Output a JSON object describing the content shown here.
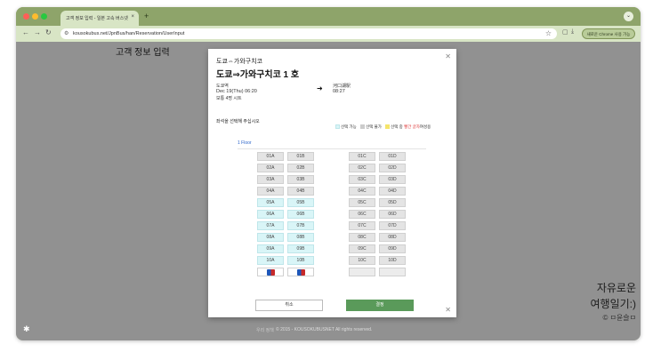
{
  "browser": {
    "tab_title": "고객 정보 입력 - 일본 고속 버스넷",
    "tab_close": "×",
    "new_tab": "+",
    "url": "kousokubus.net/JpnBus/han/Reservation/UserInput",
    "chrome_pill": "새로운 Chrome 사용 가능",
    "traffic_colors": [
      "#ff5f57",
      "#febc2e",
      "#28c840"
    ]
  },
  "page": {
    "title": "고객 정보 입력",
    "footer_link": "우리 정책",
    "footer_copy": "© 2015 - KOUSOKUBUSNET All rights reserved."
  },
  "modal": {
    "route_sub": "도쿄⇔가와구치코",
    "route_title": "도쿄⇒가와구치코 1 호",
    "departure": {
      "name": "도쿄역",
      "time": "Dec 19(Thu) 06:20",
      "seats_left": "보통 4명 시트"
    },
    "arrival": {
      "name": "河口湖駅",
      "time": "08:27"
    },
    "select_prompt": "좌석을 선택해 주십시오",
    "legend": {
      "available": "선택 가능",
      "unavailable": "선택 불가",
      "selected": "선택 중",
      "female_red": "빨간 글자",
      "female_suffix": "여성용",
      "available_color": "#d9f5f7",
      "unavailable_color": "#cccccc",
      "selected_color": "#f5e46b"
    },
    "floor": "1 Floor",
    "rows": [
      {
        "left": [
          "01A",
          "01B"
        ],
        "right": [
          "01C",
          "01D"
        ],
        "left_state": "gray"
      },
      {
        "left": [
          "02A",
          "02B"
        ],
        "right": [
          "02C",
          "02D"
        ],
        "left_state": "gray"
      },
      {
        "left": [
          "03A",
          "03B"
        ],
        "right": [
          "03C",
          "03D"
        ],
        "left_state": "gray"
      },
      {
        "left": [
          "04A",
          "04B"
        ],
        "right": [
          "04C",
          "04D"
        ],
        "left_state": "gray"
      },
      {
        "left": [
          "05A",
          "05B"
        ],
        "right": [
          "05C",
          "05D"
        ],
        "left_state": "cyan"
      },
      {
        "left": [
          "06A",
          "06B"
        ],
        "right": [
          "06C",
          "06D"
        ],
        "left_state": "cyan"
      },
      {
        "left": [
          "07A",
          "07B"
        ],
        "right": [
          "07C",
          "07D"
        ],
        "left_state": "cyan"
      },
      {
        "left": [
          "08A",
          "08B"
        ],
        "right": [
          "08C",
          "08D"
        ],
        "left_state": "cyan"
      },
      {
        "left": [
          "09A",
          "09B"
        ],
        "right": [
          "09C",
          "09D"
        ],
        "left_state": "cyan"
      },
      {
        "left": [
          "10A",
          "10B"
        ],
        "right": [
          "10C",
          "10D"
        ],
        "left_state": "cyan"
      }
    ],
    "cancel_label": "취소",
    "ok_label": "결정"
  },
  "watermark": {
    "line1": "자유로운",
    "line2": "여행일기:)",
    "line3": "© ㅁ윤슬ㅁ"
  }
}
